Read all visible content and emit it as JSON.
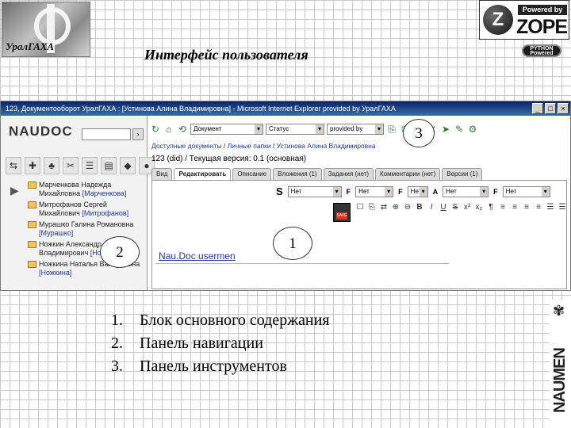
{
  "slide": {
    "title": "Интерфейс пользователя",
    "logo_text": "УралГАХА",
    "zope": {
      "powered_by": "Powered by",
      "word": "ZOPE",
      "letter": "Z"
    },
    "python_badge_line1": "PYTHON",
    "python_badge_line2": "Powered",
    "side_brand": "NAUMEN"
  },
  "browser": {
    "window_title": "123, Документооборот УралГАХА : [Устинова Алина Владимировна] - Microsoft Internet Explorer provided by УралГАХА",
    "window_buttons": [
      "_",
      "□",
      "×"
    ]
  },
  "nav": {
    "logo": "NAUDOC",
    "search_button": "›",
    "icons": [
      "⇆",
      "✚",
      "♣",
      "✂",
      "☰",
      "▤",
      "◆",
      "●"
    ],
    "tree_arrow": "▶",
    "tree": [
      {
        "name": "Марченкова Надежда Михайловна",
        "login": "[Марченкова]"
      },
      {
        "name": "Митрофанов Сергей Михайлович",
        "login": "[Митрофанов]"
      },
      {
        "name": "Мурашко Галина Романовна",
        "login": "[Мурашко]"
      },
      {
        "name": "Ножкин Александр Владимирович",
        "login": "[Ножкин]"
      },
      {
        "name": "Ножкина Наталья Валерьевна",
        "login": "[Ножкина]"
      }
    ]
  },
  "toolbar": {
    "icons_left": [
      "↻",
      "⌂",
      "⟲"
    ],
    "select1": "Документ",
    "select2": "Статус",
    "select3": "provided by",
    "icons_right": [
      "⎘",
      "✉",
      "🔒",
      "✕",
      "➤",
      "✎",
      "⚙"
    ]
  },
  "breadcrumb": {
    "items": [
      "Доступные документы",
      "Личные папки",
      "Устинова Алина Владимировна"
    ],
    "separator": " / "
  },
  "document": {
    "title": "123 (did) / Текущая версия: 0.1 (основная)"
  },
  "tabs": [
    {
      "label": "Вид",
      "active": false
    },
    {
      "label": "Редактировать",
      "active": true
    },
    {
      "label": "Описание",
      "active": false
    },
    {
      "label": "Вложения (1)",
      "active": false
    },
    {
      "label": "Задания (нет)",
      "active": false
    },
    {
      "label": "Комментарии (нет)",
      "active": false
    },
    {
      "label": "Версии (1)",
      "active": false
    }
  ],
  "editor": {
    "row1": {
      "s": "S",
      "select_a": "Нет",
      "f1": "F",
      "select_b": "Нет",
      "f2": "F",
      "select_c": "Нет",
      "a": "A",
      "select_d": "Нет",
      "f3": "F",
      "select_e": "Нет"
    },
    "row2_icons": [
      "☐",
      "⎘",
      "⇄",
      "⊕",
      "⊖",
      "B",
      "I",
      "U",
      "S",
      "x²",
      "x₂",
      "¶",
      "≡",
      "≡",
      "≡",
      "≡",
      "☰",
      "☰",
      "▤",
      "▦"
    ],
    "content_text": "Nau.Doc usermen"
  },
  "callouts": {
    "one": "1",
    "two": "2",
    "three": "3"
  },
  "legend": [
    {
      "num": "1.",
      "text": "Блок основного содержания"
    },
    {
      "num": "2.",
      "text": "Панель навигации"
    },
    {
      "num": "3.",
      "text": "Панель инструментов"
    }
  ]
}
